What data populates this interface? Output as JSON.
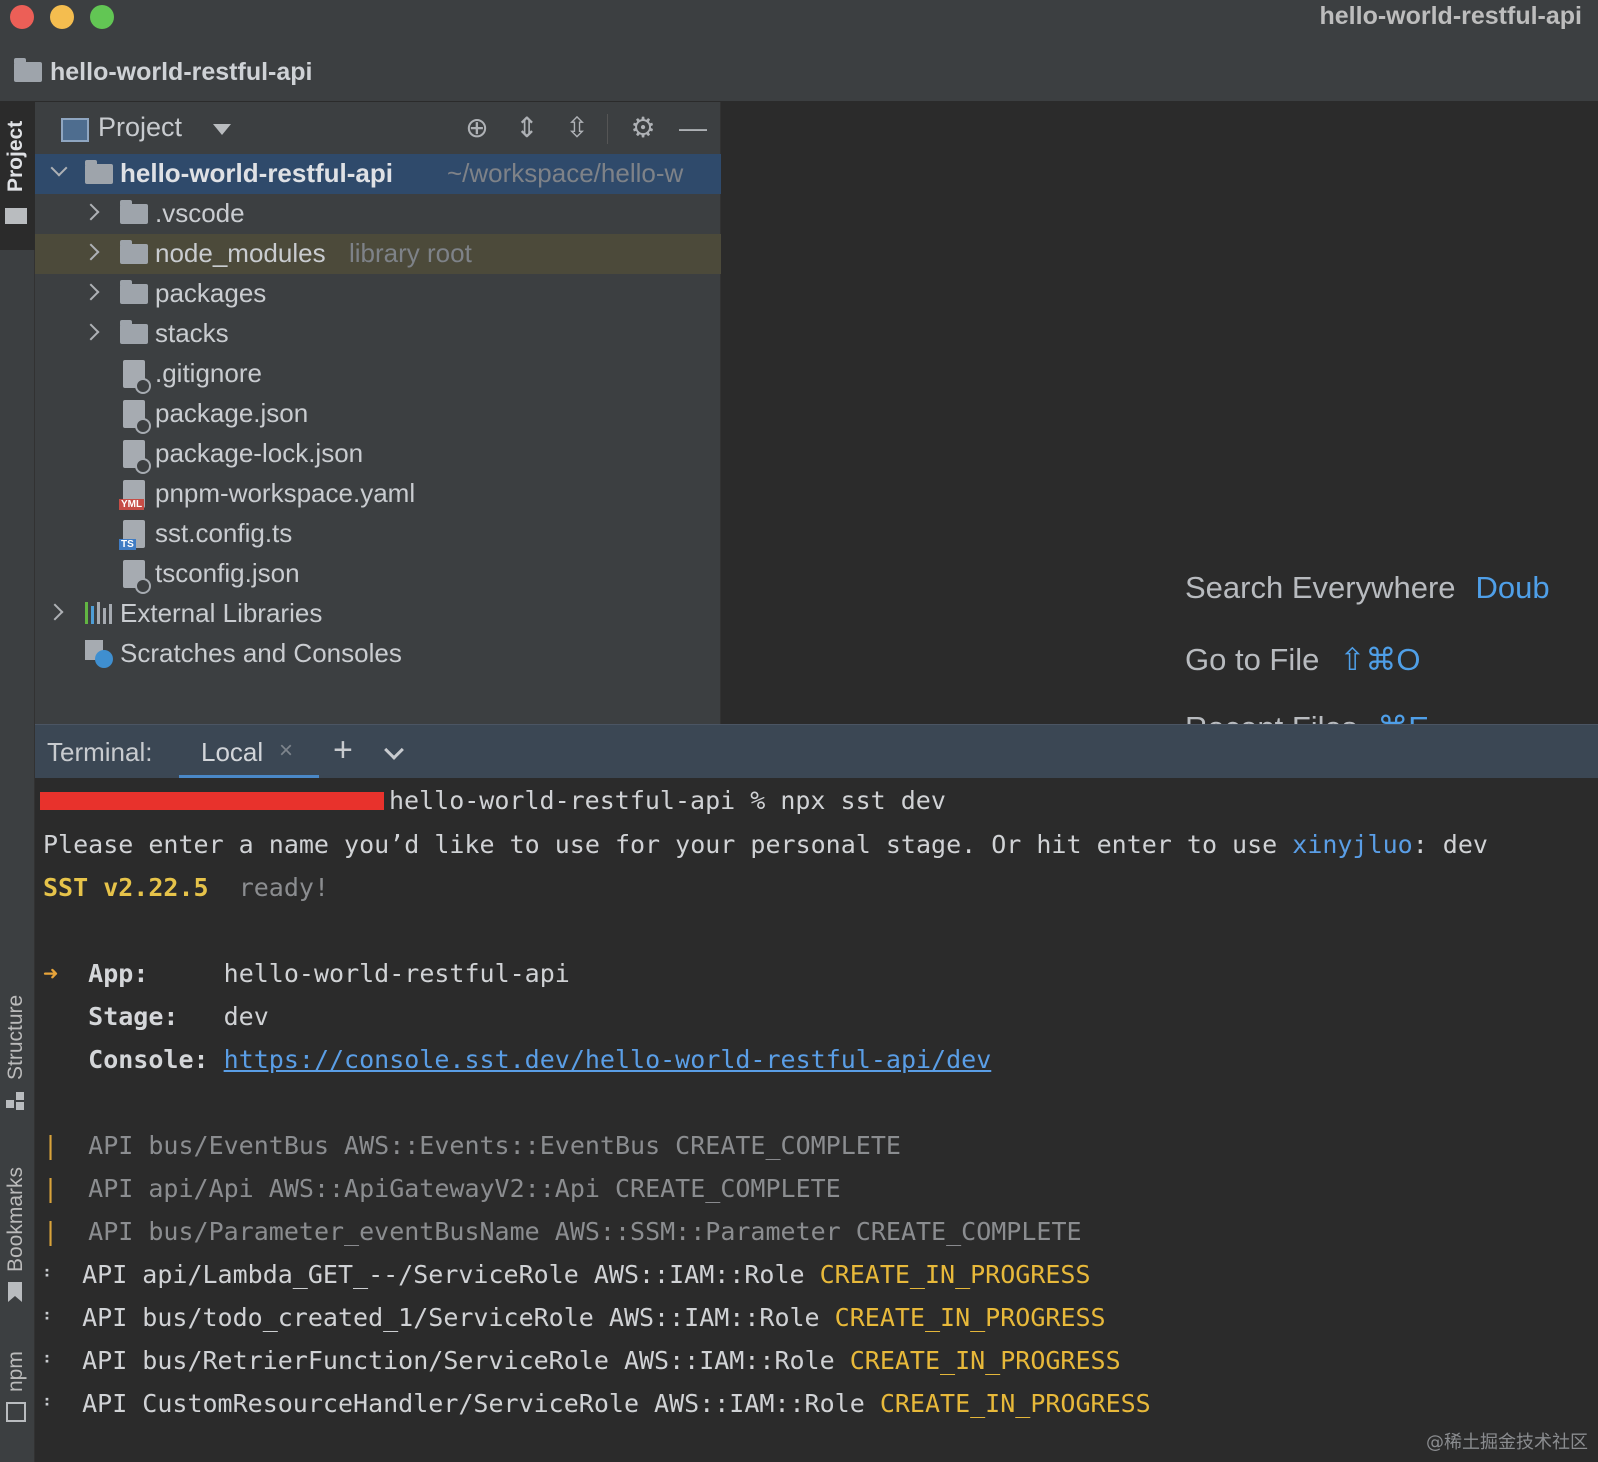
{
  "window": {
    "title": "hello-world-restful-api"
  },
  "navbar": {
    "breadcrumb": "hello-world-restful-api"
  },
  "left_stripe": {
    "project": "Project",
    "structure": "Structure",
    "bookmarks": "Bookmarks",
    "npm": "npm"
  },
  "project_panel": {
    "title": "Project",
    "root": {
      "name": "hello-world-restful-api",
      "path": "~/workspace/hello-w"
    },
    "items": [
      {
        "label": ".vscode",
        "type": "folder"
      },
      {
        "label": "node_modules",
        "hint": "library root",
        "type": "folder"
      },
      {
        "label": "packages",
        "type": "folder"
      },
      {
        "label": "stacks",
        "type": "folder"
      },
      {
        "label": ".gitignore",
        "type": "file"
      },
      {
        "label": "package.json",
        "type": "json"
      },
      {
        "label": "package-lock.json",
        "type": "json"
      },
      {
        "label": "pnpm-workspace.yaml",
        "type": "yaml"
      },
      {
        "label": "sst.config.ts",
        "type": "ts"
      },
      {
        "label": "tsconfig.json",
        "type": "json"
      },
      {
        "label": "External Libraries",
        "type": "libraries"
      },
      {
        "label": "Scratches and Consoles",
        "type": "scratches"
      }
    ]
  },
  "editor_hints": {
    "search": {
      "label": "Search Everywhere",
      "key": "Doub"
    },
    "goto_file": {
      "label": "Go to File",
      "key": "⇧⌘O"
    },
    "recent_files": {
      "label": "Recent Files",
      "key": "⌘E"
    }
  },
  "terminal": {
    "label": "Terminal:",
    "tab": "Local",
    "prompt_suffix": "hello-world-restful-api % npx sst dev",
    "line2_prefix": "Please enter a name you’d like to use for your personal stage. Or hit enter to use ",
    "line2_user": "xinyjluo",
    "line2_suffix": ": dev",
    "sst_version": "SST v2.22.5",
    "ready": "ready!",
    "app_key": "App:",
    "app_value": "hello-world-restful-api",
    "stage_key": "Stage:",
    "stage_value": "dev",
    "console_key": "Console:",
    "console_url": "https://console.sst.dev/hello-world-restful-api/dev",
    "complete_lines": [
      "API bus/EventBus AWS::Events::EventBus CREATE_COMPLETE",
      "API api/Api AWS::ApiGatewayV2::Api CREATE_COMPLETE",
      "API bus/Parameter_eventBusName AWS::SSM::Parameter CREATE_COMPLETE"
    ],
    "progress_lines": [
      {
        "text": "API api/Lambda_GET_--/ServiceRole AWS::IAM::Role ",
        "status": "CREATE_IN_PROGRESS"
      },
      {
        "text": "API bus/todo_created_1/ServiceRole AWS::IAM::Role ",
        "status": "CREATE_IN_PROGRESS"
      },
      {
        "text": "API bus/RetrierFunction/ServiceRole AWS::IAM::Role ",
        "status": "CREATE_IN_PROGRESS"
      },
      {
        "text": "API CustomResourceHandler/ServiceRole AWS::IAM::Role ",
        "status": "CREATE_IN_PROGRESS"
      }
    ]
  },
  "watermark": "@稀土掘金技术社区",
  "colors": {
    "accent_blue": "#5a9ee6",
    "status_yellow": "#e6c34a",
    "redaction": "#e8322c"
  }
}
